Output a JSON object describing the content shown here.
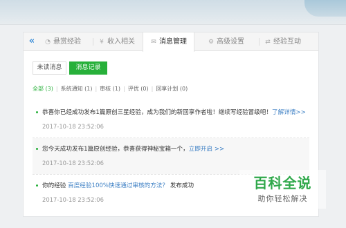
{
  "tabs": {
    "collapse_icon": "double-chevron-left-icon",
    "items": [
      {
        "label": "悬赏经验",
        "icon": "reward-icon"
      },
      {
        "label": "收入相关",
        "icon": "yen-icon"
      },
      {
        "label": "消息管理",
        "icon": "mail-icon"
      },
      {
        "label": "高级设置",
        "icon": "gear-icon"
      },
      {
        "label": "经验互动",
        "icon": "exchange-icon"
      }
    ],
    "active_index": 2
  },
  "subtabs": {
    "unread": "未读消息",
    "record": "消息记录",
    "active": "record"
  },
  "filters": [
    {
      "label": "全部 (3)",
      "active": true
    },
    {
      "label": "系统通知 (1)",
      "active": false
    },
    {
      "label": "审核 (1)",
      "active": false
    },
    {
      "label": "评优 (0)",
      "active": false
    },
    {
      "label": "回享计划 (0)",
      "active": false
    }
  ],
  "messages": [
    {
      "text": "恭喜你已经成功发布1篇原创三星经验，成为我们的新回享作者啦！继续写经验冒级吧！",
      "link": "了解详情>>",
      "suffix": "",
      "time": "2017-10-18 23:52:06"
    },
    {
      "text": "您今天成功发布1篇原创经验，恭喜获得神秘宝箱一个，",
      "link": "立即开启 >>",
      "suffix": "",
      "time": "2017-10-18 23:52:06"
    },
    {
      "text": "你的经验 ",
      "link": "百度经验100%快速通过审核的方法？",
      "suffix": " 发布成功",
      "time": "2017-10-18 23:52:06"
    }
  ],
  "watermark": {
    "title": "百科全说",
    "subtitle": "助你轻松解决"
  },
  "colors": {
    "accent_green": "#27b03a",
    "link_blue": "#3c7fc4"
  }
}
